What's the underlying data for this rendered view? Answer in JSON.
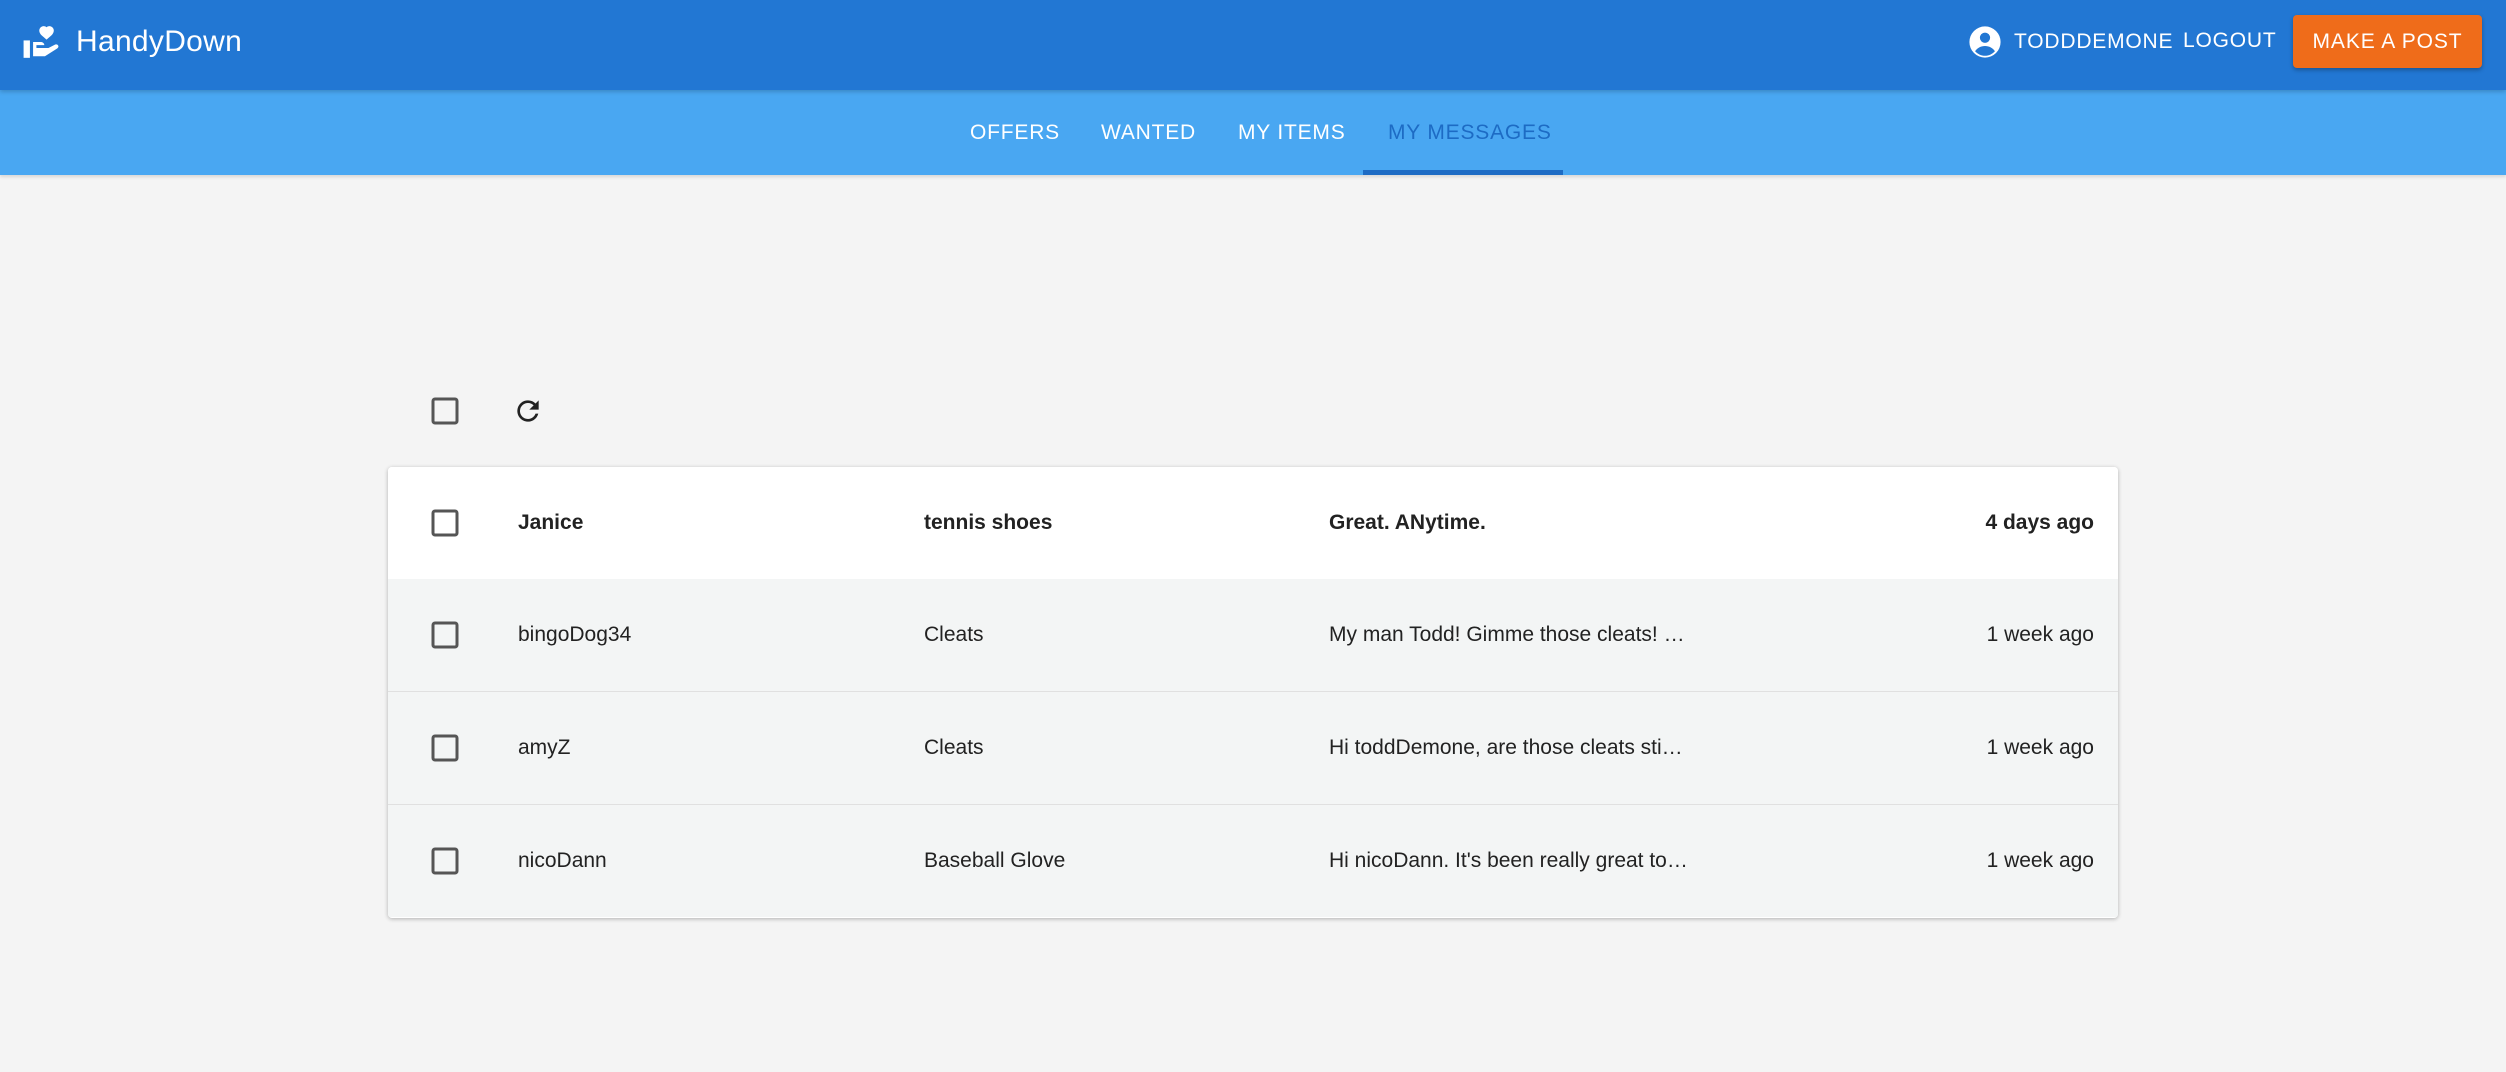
{
  "app": {
    "name": "HandyDown"
  },
  "header": {
    "username": "TODDDEMONE",
    "logout_label": "LOGOUT",
    "post_button_label": "MAKE A POST"
  },
  "tabs": [
    {
      "label": "OFFERS",
      "active": false
    },
    {
      "label": "WANTED",
      "active": false
    },
    {
      "label": "MY ITEMS",
      "active": false
    },
    {
      "label": "MY MESSAGES",
      "active": true
    }
  ],
  "messages": [
    {
      "sender": "Janice",
      "subject": "tennis shoes",
      "preview": "Great. ANytime.",
      "time": "4 days ago",
      "unread": true
    },
    {
      "sender": "bingoDog34",
      "subject": "Cleats",
      "preview": "My man Todd! Gimme those cleats! …",
      "time": "1 week ago",
      "unread": false
    },
    {
      "sender": "amyZ",
      "subject": "Cleats",
      "preview": "Hi toddDemone, are those cleats sti…",
      "time": "1 week ago",
      "unread": false
    },
    {
      "sender": "nicoDann",
      "subject": "Baseball Glove",
      "preview": "Hi nicoDann. It's been really great to…",
      "time": "1 week ago",
      "unread": false
    }
  ],
  "colors": {
    "appbar": "#2277d3",
    "tabbar": "#49a7f2",
    "active_tab": "#1d6bc4",
    "accent_button": "#ef6c1a",
    "background": "#f4f4f4"
  },
  "icons": {
    "brand": "hand-heart-icon",
    "user": "account-circle-icon",
    "refresh": "refresh-icon",
    "checkbox": "checkbox-outline-icon"
  }
}
